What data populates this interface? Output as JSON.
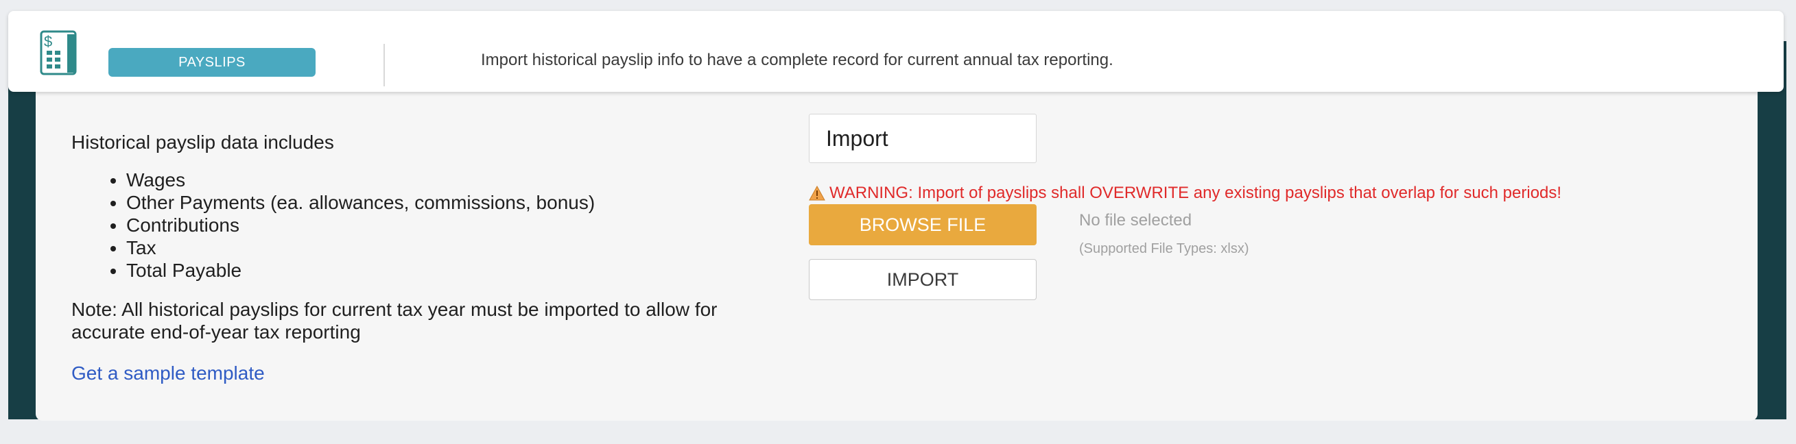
{
  "header": {
    "icon": "payslip-calculator-icon",
    "badge_label": "PAYSLIPS",
    "description": "Import historical payslip info to have a complete record for current annual tax reporting."
  },
  "left": {
    "heading": "Historical payslip data includes",
    "items": [
      "Wages",
      "Other Payments (ea. allowances, commissions, bonus)",
      "Contributions",
      "Tax",
      "Total Payable"
    ],
    "note": "Note: All historical payslips for current tax year must be imported to allow for accurate end-of-year tax reporting",
    "template_link": "Get a sample template"
  },
  "right": {
    "import_value": "Import",
    "warning_icon": "warning-triangle-icon",
    "warning": "WARNING: Import of payslips shall OVERWRITE any existing payslips that overlap for such periods!",
    "browse_label": "BROWSE FILE",
    "file_status": "No file selected",
    "file_types": "(Supported File Types: xlsx)",
    "import_label": "IMPORT"
  },
  "colors": {
    "badge": "#4aa9c0",
    "frame": "#173e45",
    "browse": "#e9a93e",
    "warning": "#e02a2a",
    "link": "#2f5bc4"
  }
}
